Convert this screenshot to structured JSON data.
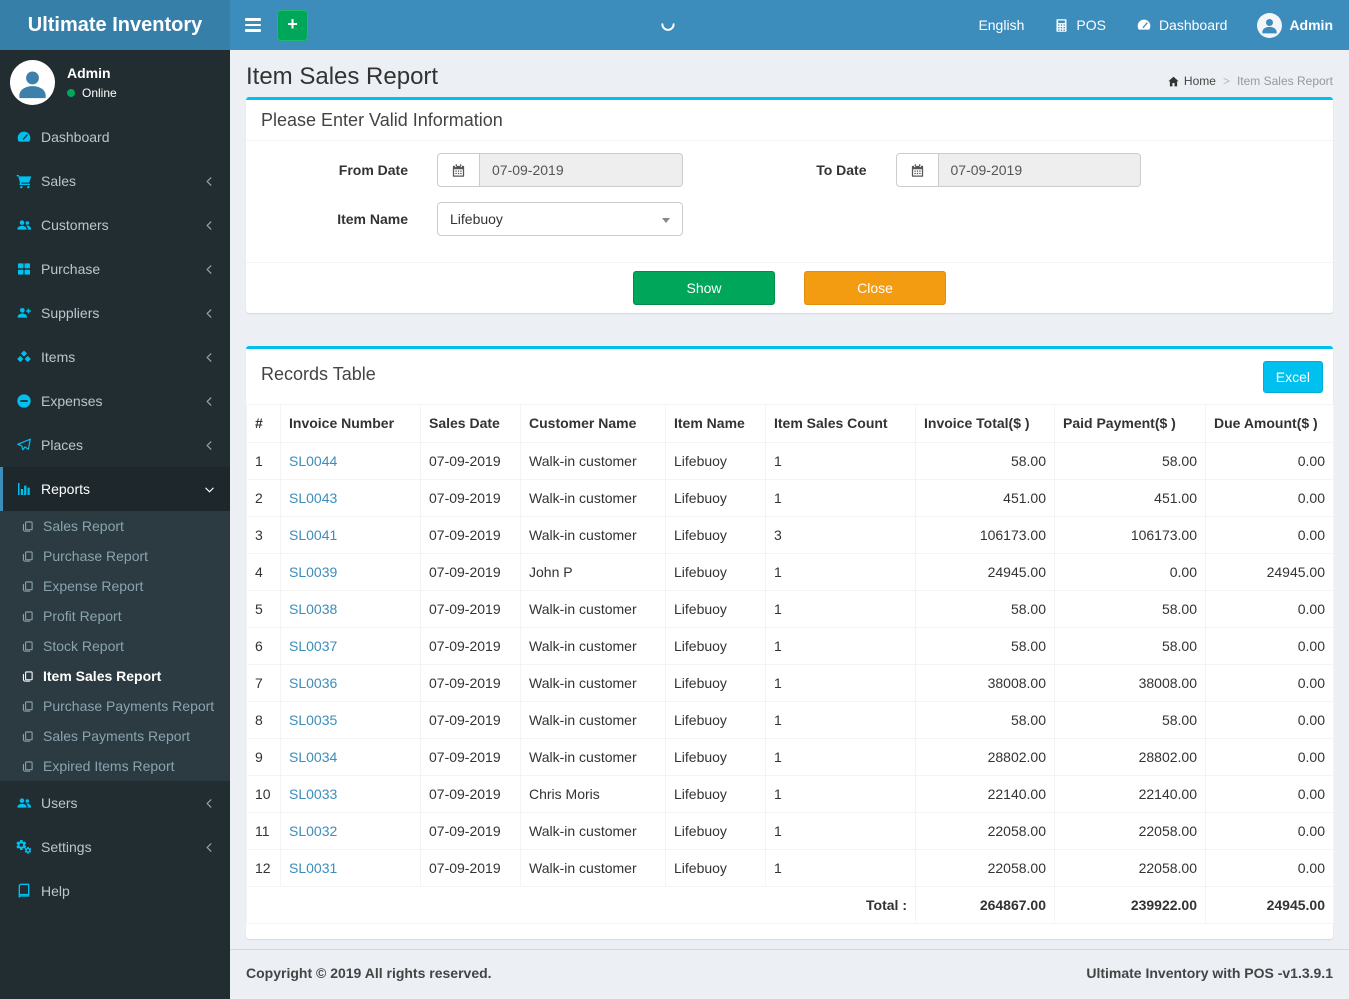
{
  "app": {
    "title": "Ultimate Inventory",
    "copyright": "Copyright © 2019 All rights reserved.",
    "version_note": "Ultimate Inventory with POS -v1.3.9.1"
  },
  "navbar": {
    "language": "English",
    "pos": "POS",
    "dashboard": "Dashboard",
    "user": "Admin",
    "add_label": "+"
  },
  "user_panel": {
    "name": "Admin",
    "status": "Online"
  },
  "sidebar": {
    "items": [
      {
        "label": "Dashboard"
      },
      {
        "label": "Sales"
      },
      {
        "label": "Customers"
      },
      {
        "label": "Purchase"
      },
      {
        "label": "Suppliers"
      },
      {
        "label": "Items"
      },
      {
        "label": "Expenses"
      },
      {
        "label": "Places"
      },
      {
        "label": "Reports"
      },
      {
        "label": "Users"
      },
      {
        "label": "Settings"
      },
      {
        "label": "Help"
      }
    ],
    "submenu": [
      "Sales Report",
      "Purchase Report",
      "Expense Report",
      "Profit Report",
      "Stock Report",
      "Item Sales Report",
      "Purchase Payments Report",
      "Sales Payments Report",
      "Expired Items Report"
    ],
    "active_item": "Reports",
    "active_subitem": "Item Sales Report"
  },
  "page": {
    "title": "Item Sales Report",
    "breadcrumb": {
      "home": "Home",
      "current": "Item Sales Report"
    }
  },
  "filter": {
    "box_title": "Please Enter Valid Information",
    "from_date": {
      "label": "From Date",
      "value": "07-09-2019"
    },
    "to_date": {
      "label": "To Date",
      "value": "07-09-2019"
    },
    "item_name": {
      "label": "Item Name",
      "value": "Lifebuoy"
    },
    "show_label": "Show",
    "close_label": "Close"
  },
  "records": {
    "box_title": "Records Table",
    "excel_label": "Excel",
    "columns": [
      "#",
      "Invoice Number",
      "Sales Date",
      "Customer Name",
      "Item Name",
      "Item Sales Count",
      "Invoice Total($ )",
      "Paid Payment($ )",
      "Due Amount($ )"
    ],
    "rows": [
      {
        "n": "1",
        "inv": "SL0044",
        "date": "07-09-2019",
        "cust": "Walk-in customer",
        "item": "Lifebuoy",
        "cnt": "1",
        "total": "58.00",
        "paid": "58.00",
        "due": "0.00"
      },
      {
        "n": "2",
        "inv": "SL0043",
        "date": "07-09-2019",
        "cust": "Walk-in customer",
        "item": "Lifebuoy",
        "cnt": "1",
        "total": "451.00",
        "paid": "451.00",
        "due": "0.00"
      },
      {
        "n": "3",
        "inv": "SL0041",
        "date": "07-09-2019",
        "cust": "Walk-in customer",
        "item": "Lifebuoy",
        "cnt": "3",
        "total": "106173.00",
        "paid": "106173.00",
        "due": "0.00"
      },
      {
        "n": "4",
        "inv": "SL0039",
        "date": "07-09-2019",
        "cust": "John P",
        "item": "Lifebuoy",
        "cnt": "1",
        "total": "24945.00",
        "paid": "0.00",
        "due": "24945.00"
      },
      {
        "n": "5",
        "inv": "SL0038",
        "date": "07-09-2019",
        "cust": "Walk-in customer",
        "item": "Lifebuoy",
        "cnt": "1",
        "total": "58.00",
        "paid": "58.00",
        "due": "0.00"
      },
      {
        "n": "6",
        "inv": "SL0037",
        "date": "07-09-2019",
        "cust": "Walk-in customer",
        "item": "Lifebuoy",
        "cnt": "1",
        "total": "58.00",
        "paid": "58.00",
        "due": "0.00"
      },
      {
        "n": "7",
        "inv": "SL0036",
        "date": "07-09-2019",
        "cust": "Walk-in customer",
        "item": "Lifebuoy",
        "cnt": "1",
        "total": "38008.00",
        "paid": "38008.00",
        "due": "0.00"
      },
      {
        "n": "8",
        "inv": "SL0035",
        "date": "07-09-2019",
        "cust": "Walk-in customer",
        "item": "Lifebuoy",
        "cnt": "1",
        "total": "58.00",
        "paid": "58.00",
        "due": "0.00"
      },
      {
        "n": "9",
        "inv": "SL0034",
        "date": "07-09-2019",
        "cust": "Walk-in customer",
        "item": "Lifebuoy",
        "cnt": "1",
        "total": "28802.00",
        "paid": "28802.00",
        "due": "0.00"
      },
      {
        "n": "10",
        "inv": "SL0033",
        "date": "07-09-2019",
        "cust": "Chris Moris",
        "item": "Lifebuoy",
        "cnt": "1",
        "total": "22140.00",
        "paid": "22140.00",
        "due": "0.00"
      },
      {
        "n": "11",
        "inv": "SL0032",
        "date": "07-09-2019",
        "cust": "Walk-in customer",
        "item": "Lifebuoy",
        "cnt": "1",
        "total": "22058.00",
        "paid": "22058.00",
        "due": "0.00"
      },
      {
        "n": "12",
        "inv": "SL0031",
        "date": "07-09-2019",
        "cust": "Walk-in customer",
        "item": "Lifebuoy",
        "cnt": "1",
        "total": "22058.00",
        "paid": "22058.00",
        "due": "0.00"
      }
    ],
    "total": {
      "label": "Total :",
      "invoice_total": "264867.00",
      "paid": "239922.00",
      "due": "24945.00"
    }
  },
  "colors": {
    "navbar": "#3c8dbc",
    "logo_bg": "#367fa9",
    "sidebar_bg": "#222d32",
    "info": "#00c0ef",
    "success": "#00a65a",
    "warning": "#f39c12"
  }
}
